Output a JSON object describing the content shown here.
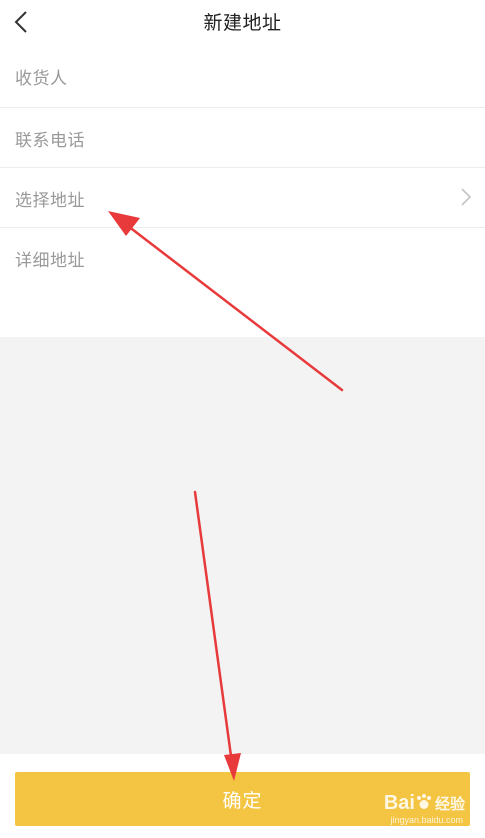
{
  "header": {
    "title": "新建地址",
    "back_icon": "chevron-left-icon"
  },
  "form": {
    "fields": [
      {
        "label": "收货人"
      },
      {
        "label": "联系电话"
      },
      {
        "label": "选择地址",
        "icon": "chevron-right-icon"
      },
      {
        "label": "详细地址"
      }
    ]
  },
  "footer": {
    "confirm_label": "确定"
  },
  "watermark": {
    "brand_left": "Bai",
    "brand_right": "经验",
    "url": "jingyan.baidu.com"
  },
  "colors": {
    "accent": "#f4c543",
    "annotation_arrow": "#e8393b",
    "placeholder_text": "#999999",
    "background": "#f3f3f3"
  }
}
